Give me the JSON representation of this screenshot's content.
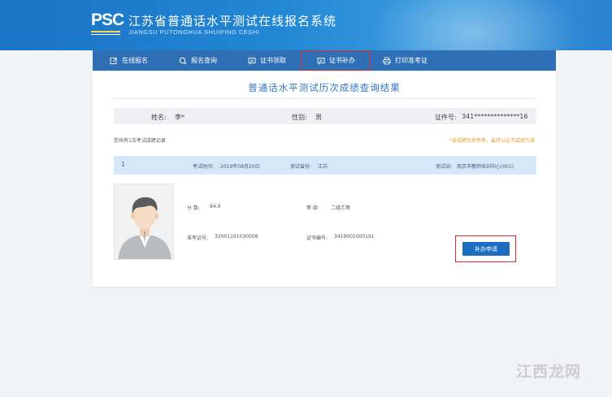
{
  "header": {
    "logo_text": "PSC",
    "title": "江苏省普通话水平测试在线报名系统",
    "subtitle": "JIANGSU PUTONGHUA SHUIPING CESHI"
  },
  "nav": {
    "items": [
      {
        "label": "在线报名",
        "icon": "edit-icon"
      },
      {
        "label": "报名查询",
        "icon": "search-icon"
      },
      {
        "label": "证书领取",
        "icon": "certificate-icon"
      },
      {
        "label": "证书补办",
        "icon": "certificate-reissue-icon",
        "highlighted": true
      },
      {
        "label": "打印准考证",
        "icon": "printer-icon"
      }
    ]
  },
  "result": {
    "title": "普通话水平测试历次成绩查询结果",
    "name_label": "姓名:",
    "name_value": "李*",
    "gender_label": "性别:",
    "gender_value": "男",
    "id_label": "证件号:",
    "id_value": "341**************16",
    "count_text": "您共有1次考试成绩记录",
    "note_text": "*该成绩仅供参考，最终以证书成绩为准"
  },
  "record": {
    "index": "1",
    "exam_time_label": "考试时间:",
    "exam_time_value": "2019年09月20日",
    "province_label": "测试省份:",
    "province_value": "江苏",
    "station_label": "测试站:",
    "station_value": "南京市教师培训中心(001)",
    "score_label": "分 数:",
    "score_value": "84.9",
    "level_label": "等 级:",
    "level_value": "二级乙等",
    "ticket_label": "准考证号:",
    "ticket_value": "32001191030008",
    "cert_label": "证书编号:",
    "cert_value": "3419001000191",
    "apply_button": "补办申请"
  },
  "watermark": "江西龙网",
  "colors": {
    "banner": "#2287d4",
    "nav_bg": "#2f6fb5",
    "title_blue": "#2f74c0",
    "record_head_bg": "#d6e8f7",
    "button": "#1e6cc2",
    "highlight_red": "#e02b2b",
    "note_orange": "#e89b2f"
  }
}
